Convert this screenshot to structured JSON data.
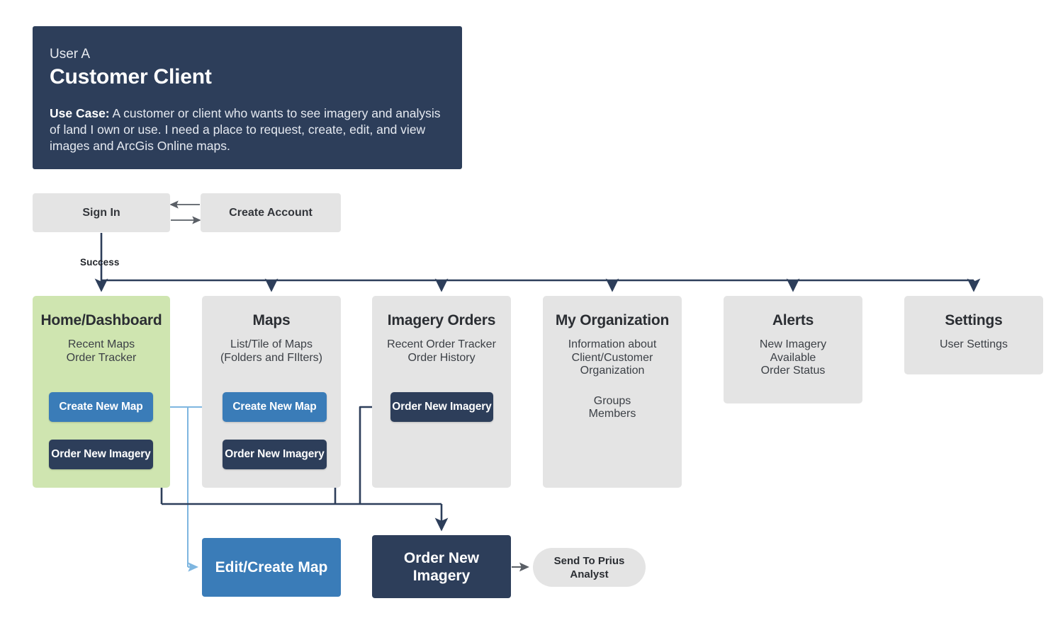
{
  "persona": {
    "user_label": "User A",
    "title": "Customer Client",
    "use_case_label": "Use Case:",
    "use_case_text": " A customer or client who wants to see imagery and analysis of land I own or use. I need a place to request, create, edit, and view images and ArcGis Online maps."
  },
  "auth": {
    "sign_in": "Sign In",
    "create_account": "Create Account",
    "success_label": "Success"
  },
  "sections": {
    "home": {
      "title": "Home/Dashboard",
      "subtitle": "Recent Maps\nOrder Tracker",
      "create_map_button": "Create New Map",
      "order_imagery_button": "Order New Imagery"
    },
    "maps": {
      "title": "Maps",
      "subtitle": "List/Tile of Maps\n(Folders and FIlters)",
      "create_map_button": "Create New Map",
      "order_imagery_button": "Order New Imagery"
    },
    "imagery_orders": {
      "title": "Imagery Orders",
      "subtitle": "Recent Order Tracker\nOrder History",
      "order_imagery_button": "Order New Imagery"
    },
    "my_organization": {
      "title": "My Organization",
      "subtitle": "Information about\nClient/Customer\nOrganization",
      "subtitle2": "Groups\nMembers"
    },
    "alerts": {
      "title": "Alerts",
      "subtitle": "New Imagery\nAvailable\nOrder Status"
    },
    "settings": {
      "title": "Settings",
      "subtitle": "User Settings"
    }
  },
  "outcomes": {
    "edit_create_map": "Edit/Create Map",
    "order_new_imagery": "Order New\nImagery",
    "send_to_analyst": "Send To Prius\nAnalyst"
  },
  "colors": {
    "navy": "#2d3e5a",
    "blue": "#3a7cb8",
    "light_blue_connector": "#7eb6e0",
    "green_card": "#cfe5b0",
    "grey_card": "#e4e4e4",
    "grey_arrow": "#5a5f66",
    "background": "#ffffff"
  }
}
